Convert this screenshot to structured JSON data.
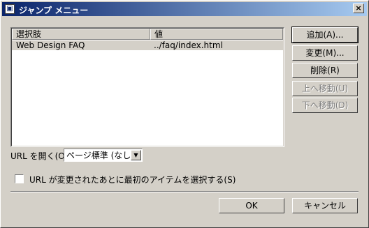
{
  "window": {
    "title": "ジャンプ メニュー",
    "close_label": "×"
  },
  "list": {
    "columns": [
      "選択肢",
      "値"
    ],
    "rows": [
      {
        "choice": "Web Design FAQ",
        "value": "../faq/index.html"
      }
    ]
  },
  "buttons": {
    "add": "追加(A)...",
    "change": "変更(M)...",
    "delete": "削除(R)",
    "move_up": "上へ移動(U)",
    "move_down": "下へ移動(D)",
    "ok": "OK",
    "cancel": "キャンセル"
  },
  "url_open": {
    "label": "URL を開く(O):",
    "selected": "ページ標準 (なし)"
  },
  "checkbox": {
    "label": "URL が変更されたあとに最初のアイテムを選択する(S)",
    "checked": false
  }
}
